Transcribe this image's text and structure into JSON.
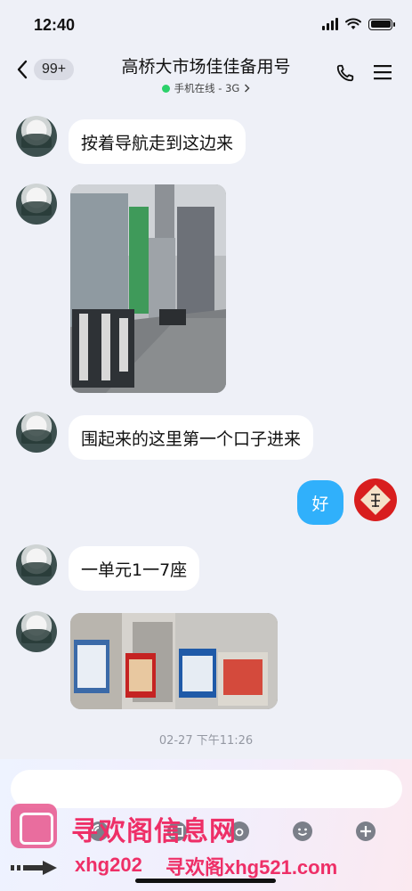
{
  "status_bar": {
    "time": "12:40"
  },
  "header": {
    "back_badge": "99+",
    "title": "高桥大市场佳佳备用号",
    "subtitle": "手机在线 - 3G",
    "online_color": "#2bd16a"
  },
  "messages": [
    {
      "side": "left",
      "type": "text",
      "text": "按着导航走到这边来"
    },
    {
      "side": "left",
      "type": "image",
      "description_icon": "street-photo"
    },
    {
      "side": "left",
      "type": "text",
      "text": "围起来的这里第一个口子进来"
    },
    {
      "side": "right",
      "type": "text",
      "text": "好"
    },
    {
      "side": "left",
      "type": "text",
      "text": "一单元1一7座"
    },
    {
      "side": "left",
      "type": "image",
      "description_icon": "entrance-photo"
    }
  ],
  "timestamp": "02-27 下午11:26",
  "composer": {
    "placeholder": ""
  },
  "watermark": {
    "text": "寻欢阁信息网",
    "domain_a": "xhg202",
    "domain_b": "寻欢阁xhg521.com"
  },
  "colors": {
    "my_bubble": "#30b0fb",
    "background": "#eef0f7",
    "watermark": "#ee2f67"
  }
}
